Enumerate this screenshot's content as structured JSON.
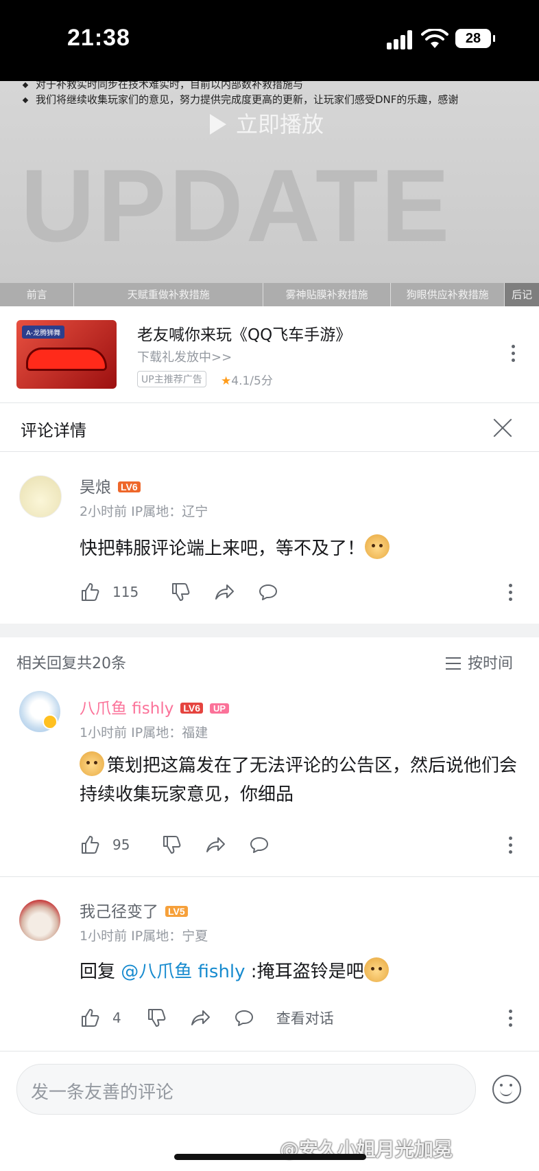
{
  "status": {
    "time": "21:38",
    "battery": "28"
  },
  "video": {
    "line1": "对于补救实时同步在技术难实时，目前以内部数补救措施与",
    "line2": "我们将继续收集玩家们的意见，努力提供完成度更高的更新，让玩家们感受DNF的乐趣，感谢",
    "play_label": "立即播放",
    "bg_word": "UPDATE",
    "chapters": [
      "前言",
      "天赋重做补救措施",
      "雾神贴膜补救措施",
      "狗眼供应补救措施",
      "后记"
    ]
  },
  "ad": {
    "title": "老友喊你来玩《QQ飞车手游》",
    "subtitle": "下载礼发放中>>",
    "badge": "UP主推荐广告",
    "rating": "4.1/5分",
    "thumb_tag": "A-龙腾狮舞"
  },
  "comment_header": {
    "title": "评论详情"
  },
  "main_comment": {
    "user": "昊烺",
    "level": "LV6",
    "meta": "2小时前  IP属地：辽宁",
    "text": "快把韩服评论端上来吧，等不及了！",
    "likes": "115"
  },
  "replies_header": {
    "count_text": "相关回复共20条",
    "sort_label": "按时间"
  },
  "replies": [
    {
      "user": "八爪鱼 fishly",
      "level": "LV6",
      "up_badge": "UP",
      "meta": "1小时前  IP属地：福建",
      "text": "策划把这篇发在了无法评论的公告区，然后说他们会持续收集玩家意见，你细品",
      "likes": "95"
    },
    {
      "user": "我己径变了",
      "level": "LV5",
      "meta": "1小时前  IP属地：宁夏",
      "reply_prefix": "回复 ",
      "mention": "@八爪鱼 fishly",
      "text": " :掩耳盗铃是吧",
      "likes": "4",
      "view_conversation": "查看对话"
    }
  ],
  "input": {
    "placeholder": "发一条友善的评论"
  },
  "watermark": "@安久小姐月光加冕",
  "colors": {
    "pink_name": "#fb7299",
    "mention": "#178bcf",
    "gray": "#9499a0"
  }
}
